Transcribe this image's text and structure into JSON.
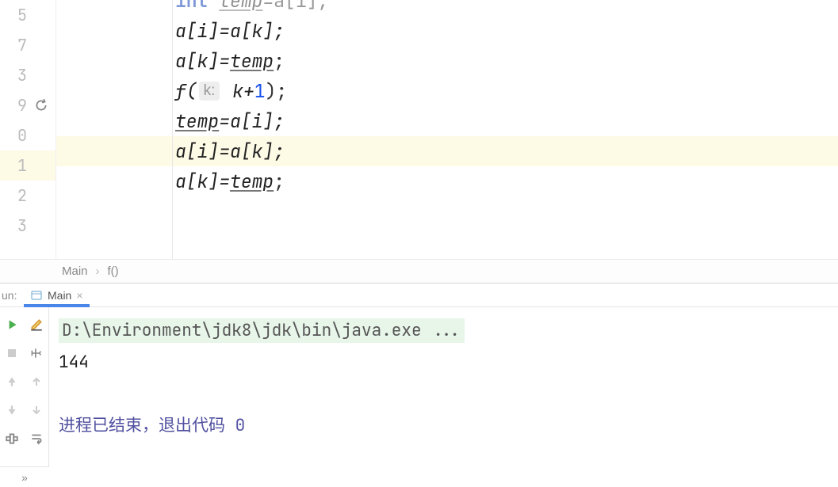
{
  "gutter": {
    "lines": [
      "5",
      "7",
      "3",
      "9",
      "0",
      "1",
      "2",
      "3"
    ],
    "icon": "recursive-icon"
  },
  "code": {
    "lines": [
      {
        "prefix_kw": "int",
        "prefix_sp": " ",
        "ident": "temp",
        "rest": "=a[i];"
      },
      {
        "text": "a[i]=a[k];"
      },
      {
        "text1": "a[k]=",
        "ident": "temp",
        "text2": ";"
      },
      {
        "text1": "f(",
        "hint": "k:",
        "text2": " k+",
        "num": "1",
        "text3": ");"
      },
      {
        "ident": "temp",
        "text": "=a[i];"
      },
      {
        "text": "a[i]=a[k];"
      },
      {
        "text1": "a[k]=",
        "ident": "temp",
        "text2": ";"
      }
    ]
  },
  "breadcrumbs": {
    "items": [
      "Main",
      "f()"
    ]
  },
  "runPanel": {
    "label": "un:",
    "tabName": "Main",
    "console": {
      "command": "D:\\Environment\\jdk8\\jdk\\bin\\java.exe ...",
      "output": "144",
      "exitMsg": "进程已结束，退出代码 0"
    }
  }
}
